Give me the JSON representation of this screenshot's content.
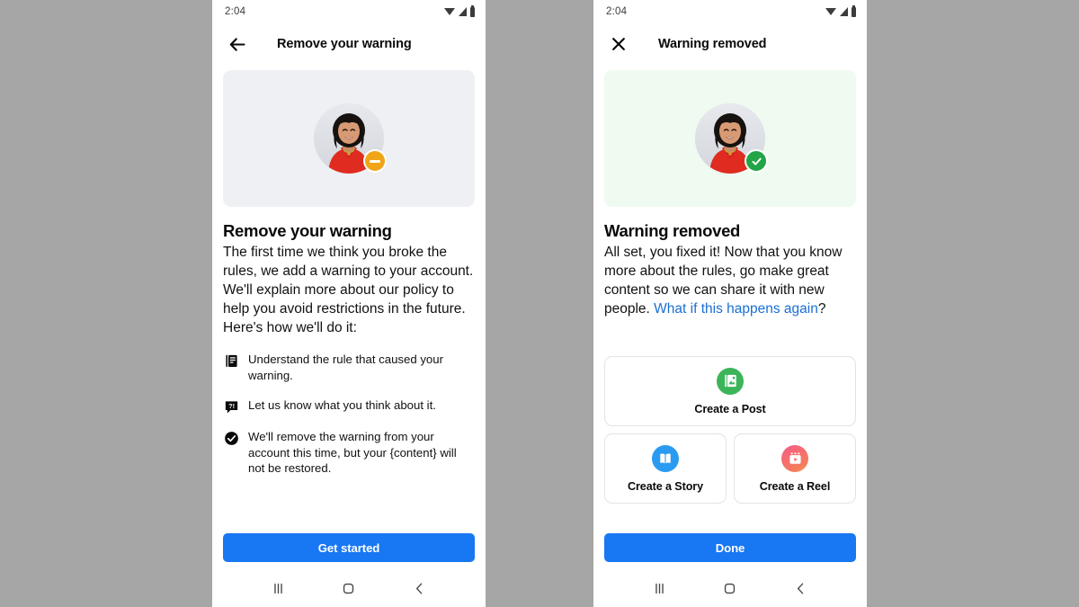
{
  "background_color": "#a6a6a6",
  "accent_color": "#1877f2",
  "link_color": "#1a6fd4",
  "screens": [
    {
      "status_bar": {
        "time": "2:04",
        "icons": [
          "wifi-icon",
          "signal-icon",
          "battery-icon"
        ]
      },
      "app_bar": {
        "nav_icon": "back-arrow-icon",
        "title": "Remove your warning"
      },
      "hero": {
        "background_color": "#eef0f4",
        "avatar_name": "user-avatar",
        "badge_icon": "minus-badge-icon",
        "badge_color": "#f0a519"
      },
      "heading": "Remove your warning",
      "body": "The first time we think you broke the rules, we add a warning to your account. We'll explain more about our policy to help you avoid restrictions in the future. Here's how we'll do it:",
      "bullets": [
        {
          "icon": "book-rules-icon",
          "text": "Understand the rule that caused your warning."
        },
        {
          "icon": "question-bubble-icon",
          "text": "Let us know what you think about it."
        },
        {
          "icon": "check-circle-icon",
          "text": "We'll remove the warning from your account this time, but your {content} will not be restored."
        }
      ],
      "cta_label": "Get started",
      "android_nav": [
        "recents-key",
        "home-key",
        "back-key"
      ]
    },
    {
      "status_bar": {
        "time": "2:04",
        "icons": [
          "wifi-icon",
          "signal-icon",
          "battery-icon"
        ]
      },
      "app_bar": {
        "nav_icon": "close-icon",
        "title": "Warning removed"
      },
      "hero": {
        "background_color": "#effaf0",
        "avatar_name": "user-avatar",
        "badge_icon": "check-badge-icon",
        "badge_color": "#22a447"
      },
      "heading": "Warning removed",
      "body_plain": "All set, you fixed it! Now that you know more about the rules, go make great content so we can share it with new people. ",
      "body_link": "What if this happens again",
      "body_tail": "?",
      "cards": [
        {
          "icon": "create-post-icon",
          "icon_color": "#3cb559",
          "label": "Create a Post"
        },
        {
          "icon": "create-story-icon",
          "icon_color": "#2a9bf0",
          "label": "Create a Story"
        },
        {
          "icon": "create-reel-icon",
          "icon_color": "#f45c8a",
          "label": "Create a Reel"
        }
      ],
      "cta_label": "Done",
      "android_nav": [
        "recents-key",
        "home-key",
        "back-key"
      ]
    }
  ]
}
